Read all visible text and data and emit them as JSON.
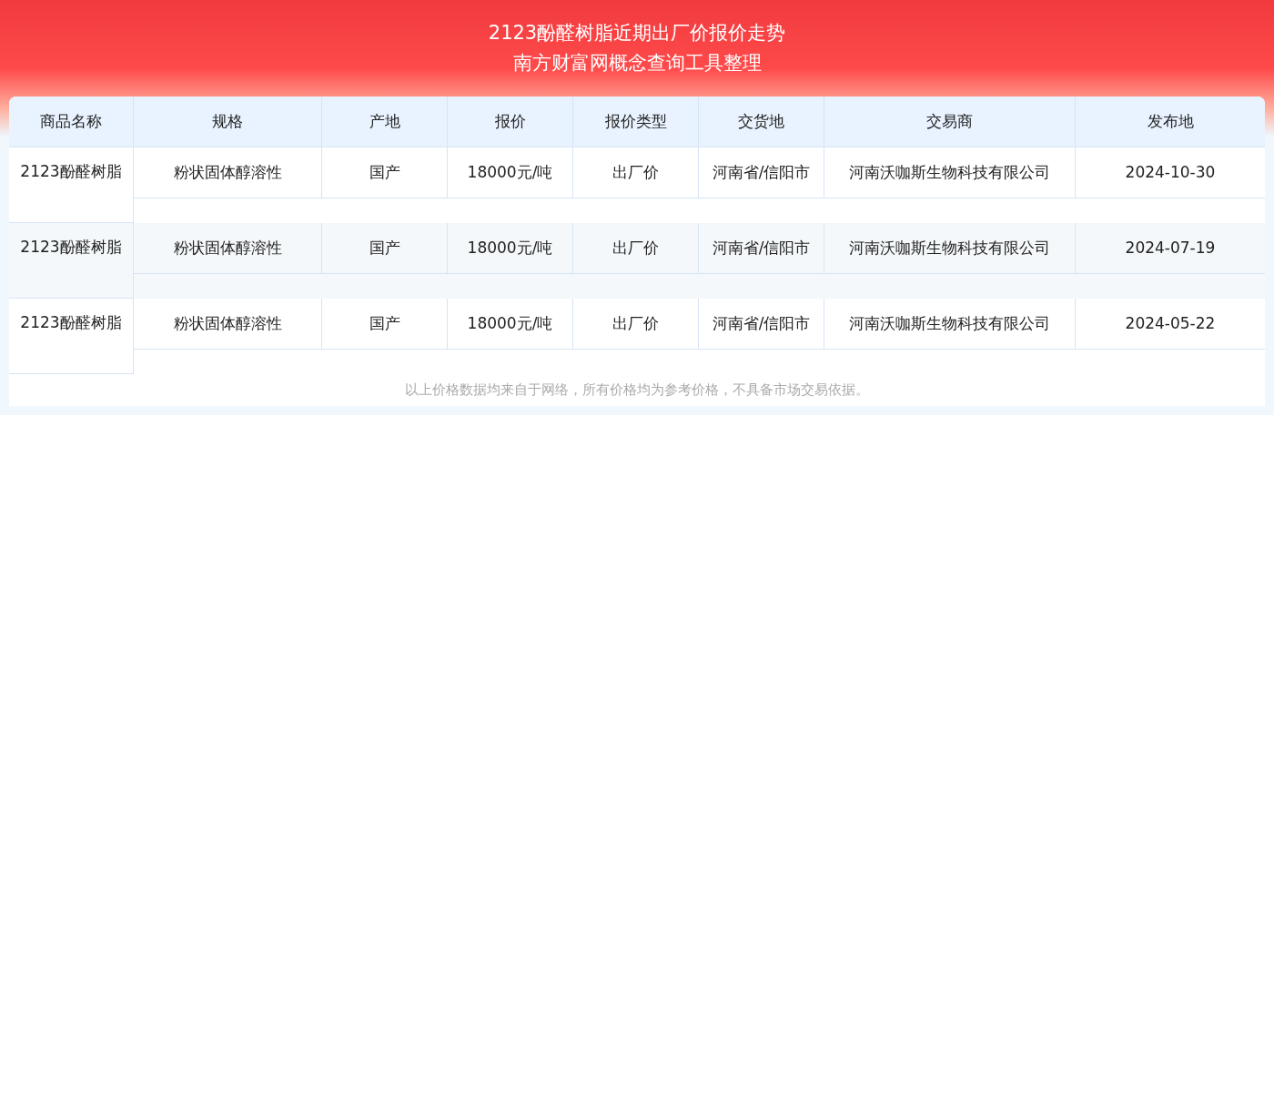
{
  "title": [
    "2123酚醛树脂近期出厂价报价走势",
    "南方财富网概念查询工具整理"
  ],
  "table": {
    "columns": [
      "商品名称",
      "规格",
      "产地",
      "报价",
      "报价类型",
      "交货地",
      "交易商",
      "发布地"
    ],
    "rows": [
      [
        "2123酚醛树脂",
        "粉状固体醇溶性",
        "国产",
        "18000元/吨",
        "出厂价",
        "河南省/信阳市",
        "河南沃咖斯生物科技有限公司",
        "2024-10-30"
      ],
      [
        "2123酚醛树脂",
        "粉状固体醇溶性",
        "国产",
        "18000元/吨",
        "出厂价",
        "河南省/信阳市",
        "河南沃咖斯生物科技有限公司",
        "2024-07-19"
      ],
      [
        "2123酚醛树脂",
        "粉状固体醇溶性",
        "国产",
        "18000元/吨",
        "出厂价",
        "河南省/信阳市",
        "河南沃咖斯生物科技有限公司",
        "2024-05-22"
      ]
    ]
  },
  "footnote": "以上价格数据均来自于网络，所有价格均为参考价格，不具备市场交易依据。"
}
